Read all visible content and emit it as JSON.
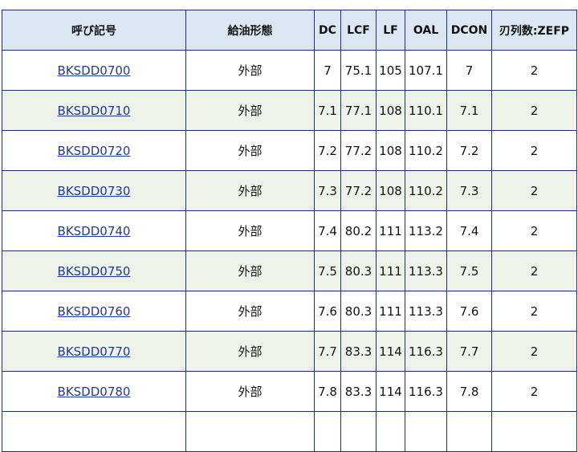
{
  "table": {
    "headers": [
      "呼び記号",
      "給油形態",
      "DC",
      "LCF",
      "LF",
      "OAL",
      "DCON",
      "刃列数:ZEFP"
    ],
    "rows": [
      {
        "code": "BKSDD0700",
        "coolant": "外部",
        "dc": "7",
        "lcf": "75.1",
        "lf": "105",
        "oal": "107.1",
        "dcon": "7",
        "zefp": "2"
      },
      {
        "code": "BKSDD0710",
        "coolant": "外部",
        "dc": "7.1",
        "lcf": "77.1",
        "lf": "108",
        "oal": "110.1",
        "dcon": "7.1",
        "zefp": "2"
      },
      {
        "code": "BKSDD0720",
        "coolant": "外部",
        "dc": "7.2",
        "lcf": "77.2",
        "lf": "108",
        "oal": "110.2",
        "dcon": "7.2",
        "zefp": "2"
      },
      {
        "code": "BKSDD0730",
        "coolant": "外部",
        "dc": "7.3",
        "lcf": "77.2",
        "lf": "108",
        "oal": "110.2",
        "dcon": "7.3",
        "zefp": "2"
      },
      {
        "code": "BKSDD0740",
        "coolant": "外部",
        "dc": "7.4",
        "lcf": "80.2",
        "lf": "111",
        "oal": "113.2",
        "dcon": "7.4",
        "zefp": "2"
      },
      {
        "code": "BKSDD0750",
        "coolant": "外部",
        "dc": "7.5",
        "lcf": "80.3",
        "lf": "111",
        "oal": "113.3",
        "dcon": "7.5",
        "zefp": "2"
      },
      {
        "code": "BKSDD0760",
        "coolant": "外部",
        "dc": "7.6",
        "lcf": "80.3",
        "lf": "111",
        "oal": "113.3",
        "dcon": "7.6",
        "zefp": "2"
      },
      {
        "code": "BKSDD0770",
        "coolant": "外部",
        "dc": "7.7",
        "lcf": "83.3",
        "lf": "114",
        "oal": "116.3",
        "dcon": "7.7",
        "zefp": "2"
      },
      {
        "code": "BKSDD0780",
        "coolant": "外部",
        "dc": "7.8",
        "lcf": "83.3",
        "lf": "114",
        "oal": "116.3",
        "dcon": "7.8",
        "zefp": "2"
      }
    ]
  },
  "colors": {
    "header_bg": "#dbe8f3",
    "border": "#1d2f6a",
    "link": "#1f3a93",
    "row_shade": "#eef3ea"
  }
}
